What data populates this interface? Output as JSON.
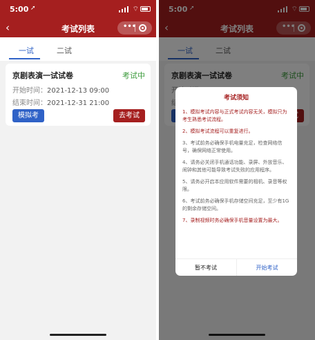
{
  "status_bar": {
    "time": "5:00",
    "location_glyph": "➚"
  },
  "nav": {
    "back_glyph": "‹",
    "title": "考试列表",
    "more_glyph": "•••"
  },
  "tabs": [
    {
      "label": "一试",
      "active": true
    },
    {
      "label": "二试",
      "active": false
    }
  ],
  "exam_card": {
    "title": "京剧表演一试试卷",
    "status": "考试中",
    "start_label": "开始时间：",
    "start_value": "2021-12-13 09:00",
    "end_label": "结束时间：",
    "end_value": "2021-12-31 21:00",
    "mock_button": "模拟考",
    "go_button": "去考试"
  },
  "modal": {
    "title": "考试须知",
    "rules": [
      {
        "text": "1、模拟考试内容与正式考试内容无关，模拟只为考生熟悉考试流程。",
        "highlight": true
      },
      {
        "text": "2、模拟考试流程可以重复进行。",
        "highlight": true
      },
      {
        "text": "3、考试前务必确保手机电量充足，检查网络信号，确保网络正常使用。",
        "highlight": false
      },
      {
        "text": "4、请务必关闭手机通话功能、录屏、外放音乐、闹钟和其他可能导致考试失败的应用程序。",
        "highlight": false
      },
      {
        "text": "5、请务必开启本应用软件需要的相机、录音等权限。",
        "highlight": false
      },
      {
        "text": "6、考试前务必确保手机存储空间充足，至少有1G的剩余存储空间。",
        "highlight": false
      },
      {
        "text": "7、录制视频时务必确保手机音量设置为最大。",
        "highlight": true
      }
    ],
    "cancel": "暂不考试",
    "confirm": "开始考试"
  },
  "colors": {
    "brand_red": "#a51f1f",
    "accent_blue": "#2f62c7",
    "status_green": "#3a9a3a"
  },
  "icons": [
    "location-arrow-icon",
    "signal-icon",
    "wifi-icon",
    "battery-icon",
    "back-chevron-icon",
    "more-dots-icon",
    "close-target-icon"
  ]
}
